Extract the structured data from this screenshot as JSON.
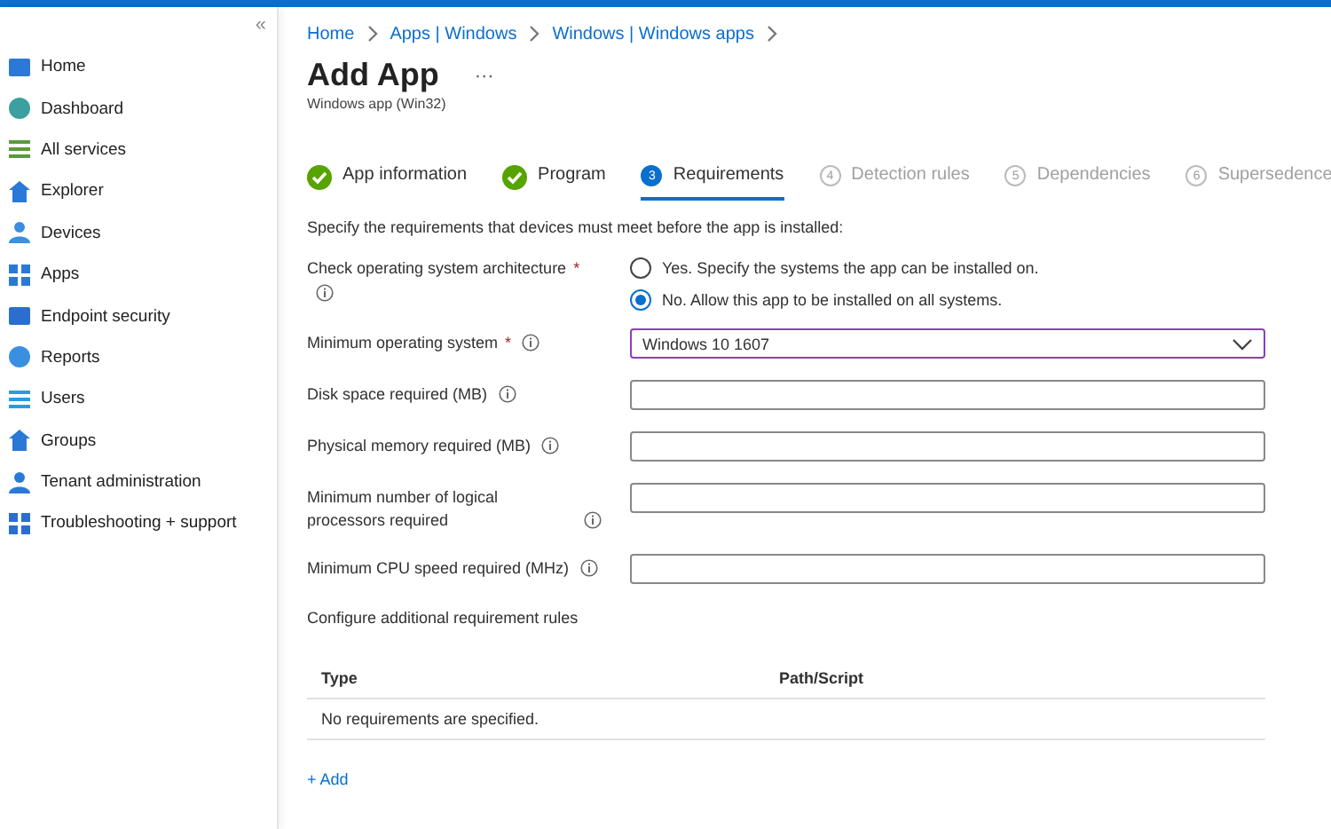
{
  "sidebar": {
    "collapse": "«",
    "items": [
      {
        "label": "Home"
      },
      {
        "label": "Dashboard"
      },
      {
        "label": "All services"
      },
      {
        "label": "Explorer"
      },
      {
        "label": "Devices"
      },
      {
        "label": "Apps"
      },
      {
        "label": "Endpoint security"
      },
      {
        "label": "Reports"
      },
      {
        "label": "Users"
      },
      {
        "label": "Groups"
      },
      {
        "label": "Tenant administration"
      },
      {
        "label": "Troubleshooting + support"
      }
    ]
  },
  "breadcrumb": [
    "Home",
    "Apps | Windows",
    "Windows | Windows apps"
  ],
  "title": "Add App",
  "more": "···",
  "subtitle": "Windows app (Win32)",
  "steps": [
    {
      "label": "App information",
      "kind": "done",
      "selected": false
    },
    {
      "label": "Program",
      "kind": "done",
      "selected": false
    },
    {
      "number": "3",
      "label": "Requirements",
      "kind": "current",
      "selected": true
    },
    {
      "number": "4",
      "label": "Detection rules",
      "kind": "pending",
      "selected": false
    },
    {
      "number": "5",
      "label": "Dependencies",
      "kind": "pending",
      "selected": false
    },
    {
      "number": "6",
      "label": "Supersedence",
      "kind": "pending",
      "selected": false
    }
  ],
  "description": "Specify the requirements that devices must meet before the app is installed:",
  "architecture": {
    "label": "Check operating system architecture",
    "required_mark": "*",
    "options": [
      {
        "label": "Yes. Specify the systems the app can be installed on.",
        "selected": false
      },
      {
        "label": "No. Allow this app to be installed on all systems.",
        "selected": true
      }
    ]
  },
  "fields": [
    {
      "label": "Minimum operating system",
      "required_mark": "*",
      "kind": "dropdown",
      "value": "Windows 10 1607"
    },
    {
      "label": "Disk space required (MB)",
      "kind": "text"
    },
    {
      "label": "Physical memory required (MB)",
      "kind": "text"
    },
    {
      "label": "Minimum number of logical processors required",
      "kind": "text"
    },
    {
      "label": "Minimum CPU speed required (MHz)",
      "kind": "text"
    }
  ],
  "rules": {
    "heading": "Configure additional requirement rules",
    "columns": [
      "Type",
      "Path/Script"
    ],
    "empty": "No requirements are specified.",
    "add": "+ Add"
  }
}
